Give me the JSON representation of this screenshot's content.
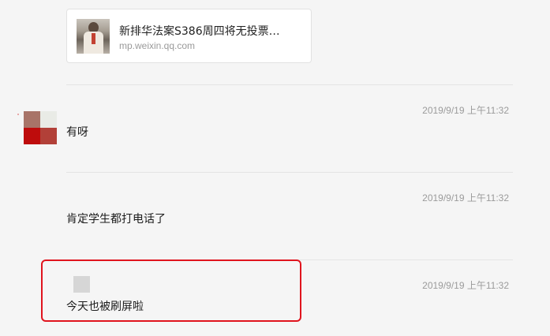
{
  "link_card": {
    "title": "新排华法案S386周四将无投票…",
    "domain": "mp.weixin.qq.com"
  },
  "messages": [
    {
      "timestamp": "2019/9/19 上午11:32",
      "text": "有呀"
    },
    {
      "timestamp": "2019/9/19 上午11:32",
      "text": "肯定学生都打电话了"
    },
    {
      "timestamp": "2019/9/19 上午11:32",
      "text": "今天也被刷屏啦"
    }
  ],
  "colors": {
    "highlight": "#e0141e",
    "avatar_tiles": [
      "#a87468",
      "#e9ebe6",
      "#be0c0c",
      "#b24038"
    ]
  }
}
